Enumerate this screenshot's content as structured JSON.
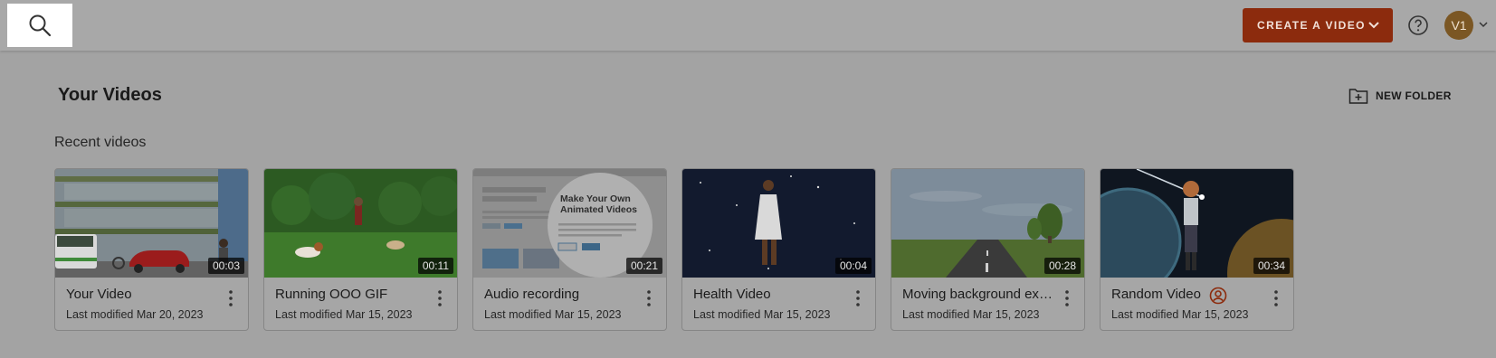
{
  "header": {
    "search_icon": "search-icon",
    "create_label": "CREATE A VIDEO",
    "help_icon": "help-circle-icon",
    "avatar_initials": "V1",
    "accent_color": "#8c2b0d"
  },
  "page": {
    "title": "Your Videos",
    "new_folder_label": "NEW FOLDER",
    "section_title": "Recent videos"
  },
  "videos": [
    {
      "title": "Your Video",
      "modified": "Last modified Mar 20, 2023",
      "duration": "00:03"
    },
    {
      "title": "Running OOO GIF",
      "modified": "Last modified Mar 15, 2023",
      "duration": "00:11"
    },
    {
      "title": "Audio recording",
      "modified": "Last modified Mar 15, 2023",
      "duration": "00:21",
      "thumb_heading": "Make Your Own Animated Videos"
    },
    {
      "title": "Health Video",
      "modified": "Last modified Mar 15, 2023",
      "duration": "00:04"
    },
    {
      "title": "Moving background exa...",
      "modified": "Last modified Mar 15, 2023",
      "duration": "00:28"
    },
    {
      "title": "Random Video",
      "modified": "Last modified Mar 15, 2023",
      "duration": "00:34"
    }
  ]
}
